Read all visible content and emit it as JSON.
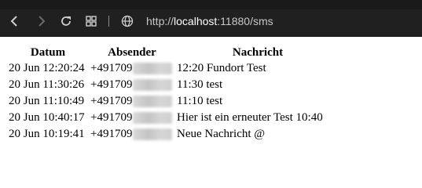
{
  "browser": {
    "url_prefix": "http://",
    "url_host": "localhost",
    "url_rest": ":11880/sms"
  },
  "table": {
    "headers": [
      "Datum",
      "Absender",
      "Nachricht"
    ],
    "rows": [
      {
        "date": "20 Jun 12:20:24",
        "sender": "+491709",
        "message": "12:20 Fundort Test"
      },
      {
        "date": "20 Jun 11:30:26",
        "sender": "+491709",
        "message": "11:30 test"
      },
      {
        "date": "20 Jun 11:10:49",
        "sender": "+491709",
        "message": "11:10 test"
      },
      {
        "date": "20 Jun 10:40:17",
        "sender": "+491709",
        "message": "Hier ist ein erneuter Test 10:40"
      },
      {
        "date": "20 Jun 10:19:41",
        "sender": "+491709",
        "message": "Neue Nachricht @"
      }
    ]
  },
  "colors": {
    "toolbar_bg": "#202020",
    "url_text": "#c8c8c8",
    "url_host": "#ffffff"
  }
}
